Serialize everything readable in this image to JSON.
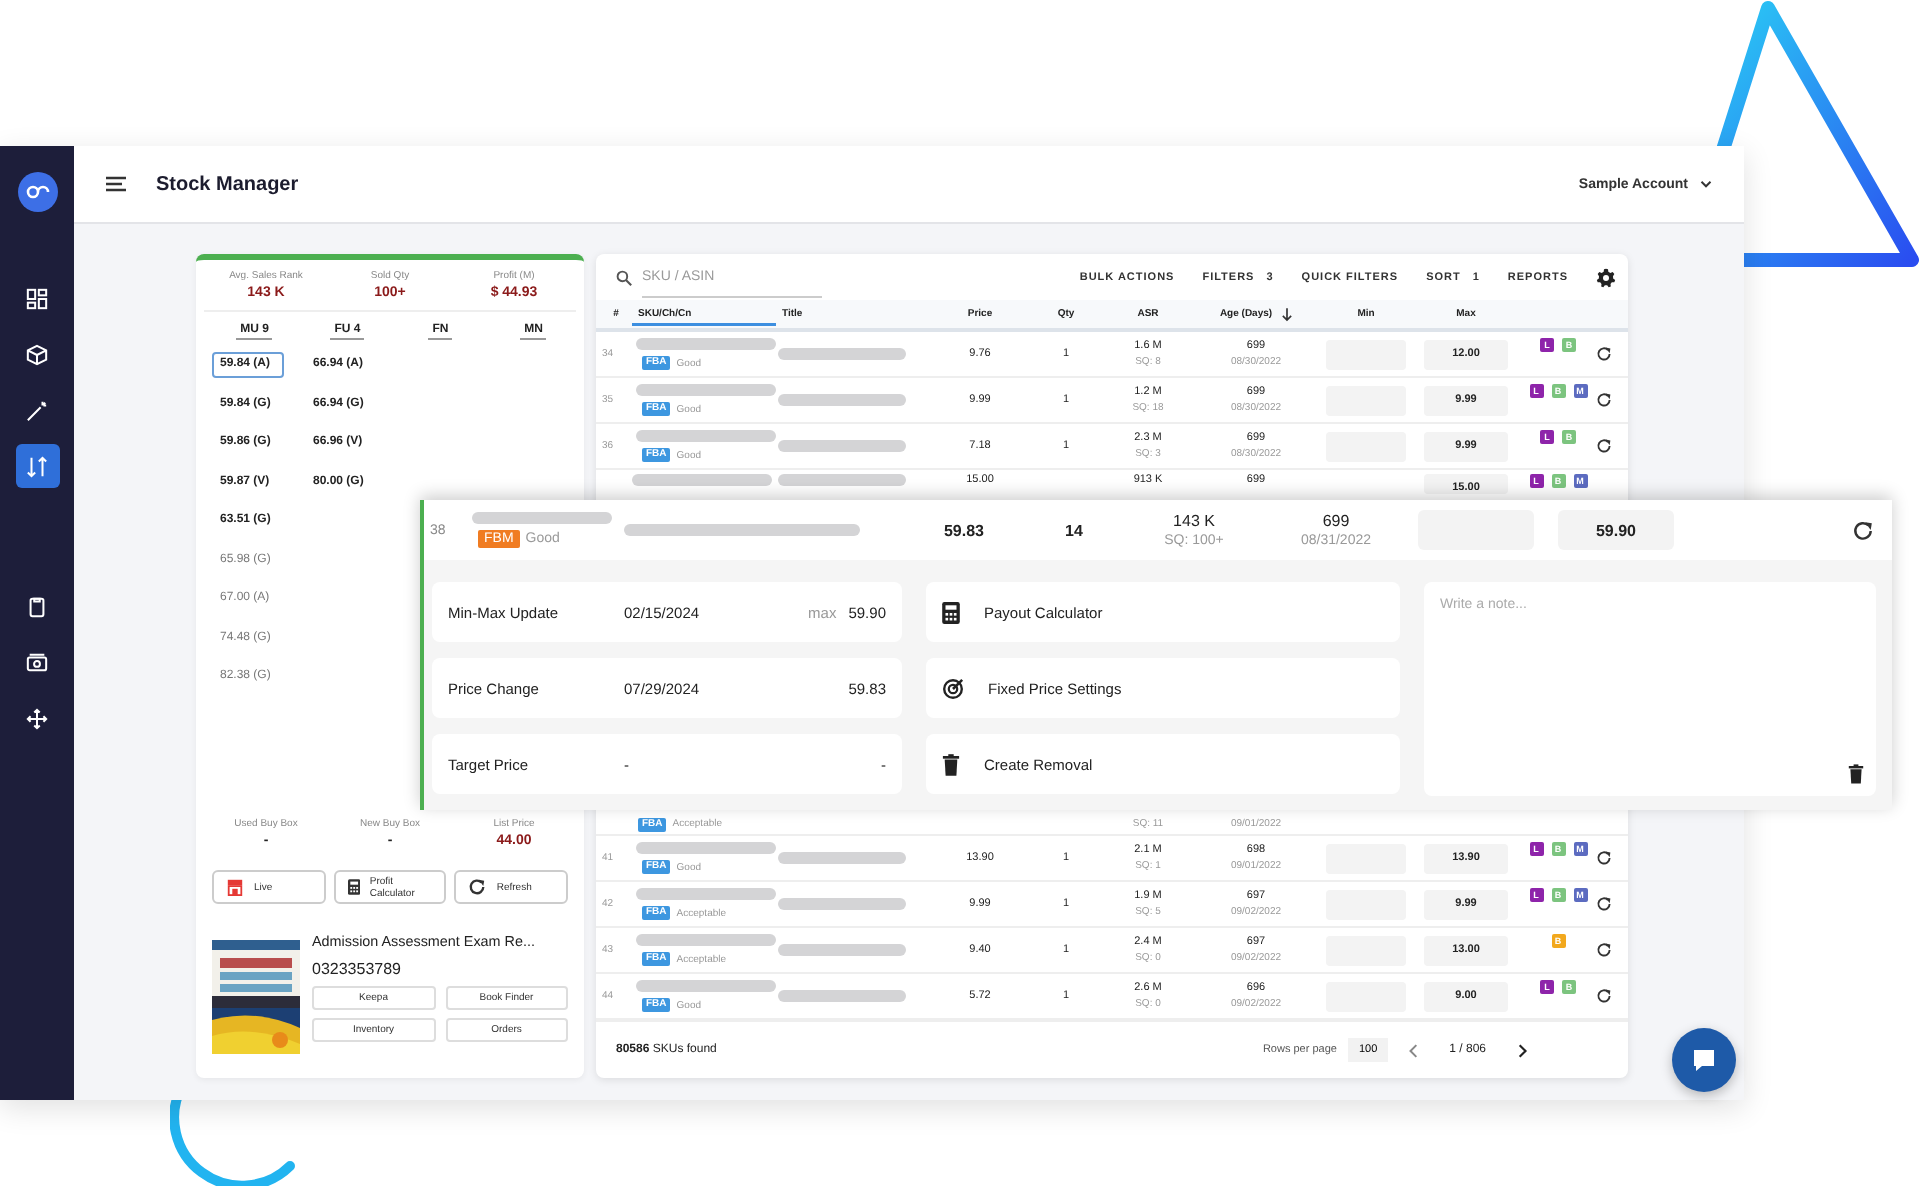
{
  "app": {
    "title": "Stock Manager",
    "account": "Sample Account"
  },
  "sidebar": {
    "items": [
      {
        "kind": "grid",
        "selected": false
      },
      {
        "kind": "cube",
        "selected": false
      },
      {
        "kind": "wand",
        "selected": false
      },
      {
        "kind": "sort",
        "selected": true
      },
      {
        "kind": "clipboard",
        "selected": false
      },
      {
        "kind": "cash",
        "selected": false
      },
      {
        "kind": "move",
        "selected": false
      }
    ]
  },
  "summary": [
    {
      "label": "Avg. Sales Rank",
      "value": "143 K"
    },
    {
      "label": "Sold Qty",
      "value": "100+"
    },
    {
      "label": "Profit (M)",
      "value": "$ 44.93"
    }
  ],
  "offers": [
    {
      "label": "MU 9",
      "prices": [
        {
          "text": "59.84 (A)",
          "selected": true,
          "muted": false
        },
        {
          "text": "59.84 (G)",
          "selected": false,
          "muted": false
        },
        {
          "text": "59.86 (G)",
          "selected": false,
          "muted": false
        },
        {
          "text": "59.87 (V)",
          "selected": false,
          "muted": false
        },
        {
          "text": "63.51 (G)",
          "selected": false,
          "muted": false
        },
        {
          "text": "65.98 (G)",
          "selected": false,
          "muted": true
        },
        {
          "text": "67.00 (A)",
          "selected": false,
          "muted": true
        },
        {
          "text": "74.48 (G)",
          "selected": false,
          "muted": true
        },
        {
          "text": "82.38 (G)",
          "selected": false,
          "muted": true
        }
      ]
    },
    {
      "label": "FU 4",
      "prices": [
        {
          "text": "66.94 (A)",
          "selected": false,
          "muted": false
        },
        {
          "text": "66.94 (G)",
          "selected": false,
          "muted": false
        },
        {
          "text": "66.96 (V)",
          "selected": false,
          "muted": false
        },
        {
          "text": "80.00 (G)",
          "selected": false,
          "muted": false
        }
      ]
    },
    {
      "label": "FN"
    },
    {
      "label": "MN"
    }
  ],
  "buy_box": [
    {
      "label": "Used Buy Box",
      "value": "-"
    },
    {
      "label": "New Buy Box",
      "value": "-"
    },
    {
      "label": "List Price",
      "value": "44.00"
    }
  ],
  "tools": [
    {
      "kind": "live",
      "label": "Live"
    },
    {
      "kind": "calculator",
      "label": "Profit Calculator"
    },
    {
      "kind": "refresh",
      "label": "Refresh"
    }
  ],
  "product": {
    "title": "Admission Assessment Exam Re...",
    "isbn": "0323353789",
    "links": [
      "Keepa",
      "Book Finder",
      "Inventory",
      "Orders"
    ]
  },
  "table": {
    "search_placeholder": "SKU / ASIN",
    "actions": [
      {
        "label": "BULK ACTIONS"
      },
      {
        "label": "FILTERS",
        "count": "3"
      },
      {
        "label": "QUICK FILTERS"
      },
      {
        "label": "SORT",
        "count": "1"
      },
      {
        "label": "REPORTS"
      }
    ],
    "columns": [
      {
        "label": "#",
        "selected": false,
        "sorted": false
      },
      {
        "label": "SKU/Ch/Cn",
        "selected": true,
        "sorted": false
      },
      {
        "label": "Title",
        "selected": false,
        "sorted": false
      },
      {
        "label": "Price",
        "selected": false,
        "sorted": false
      },
      {
        "label": "Qty",
        "selected": false,
        "sorted": false
      },
      {
        "label": "ASR",
        "selected": false,
        "sorted": false
      },
      {
        "label": "Age (Days)",
        "selected": false,
        "sorted": true
      },
      {
        "label": "Min",
        "selected": false,
        "sorted": false
      },
      {
        "label": "Max",
        "selected": false,
        "sorted": false
      }
    ],
    "rows": [
      {
        "kind": "full",
        "num": "34",
        "channel": {
          "text": "FBA",
          "color": "#3d97e0"
        },
        "condition": "Good",
        "price": "9.76",
        "qty": "1",
        "asr": "1.6 M",
        "sq": "SQ: 8",
        "age": "699",
        "date": "08/30/2022",
        "max": "12.00",
        "badges": [
          {
            "text": "L",
            "color": "#8e24aa"
          },
          {
            "text": "B",
            "color": "#7cc47f"
          }
        ]
      },
      {
        "kind": "full",
        "num": "35",
        "channel": {
          "text": "FBA",
          "color": "#3d97e0"
        },
        "condition": "Good",
        "price": "9.99",
        "qty": "1",
        "asr": "1.2 M",
        "sq": "SQ: 18",
        "age": "699",
        "date": "08/30/2022",
        "max": "9.99",
        "badges": [
          {
            "text": "L",
            "color": "#8e24aa"
          },
          {
            "text": "B",
            "color": "#7cc47f"
          },
          {
            "text": "M",
            "color": "#5c6bc0"
          }
        ]
      },
      {
        "kind": "full",
        "num": "36",
        "channel": {
          "text": "FBA",
          "color": "#3d97e0"
        },
        "condition": "Good",
        "price": "7.18",
        "qty": "1",
        "asr": "2.3 M",
        "sq": "SQ: 3",
        "age": "699",
        "date": "08/30/2022",
        "max": "9.99",
        "badges": [
          {
            "text": "L",
            "color": "#8e24aa"
          },
          {
            "text": "B",
            "color": "#7cc47f"
          }
        ]
      },
      {
        "kind": "top",
        "price": "15.00",
        "asr": "913 K",
        "age": "699",
        "max": "15.00",
        "badges": [
          {
            "text": "L",
            "color": "#8e24aa"
          },
          {
            "text": "B",
            "color": "#7cc47f"
          },
          {
            "text": "M",
            "color": "#5c6bc0"
          }
        ]
      },
      {
        "kind": "bottom",
        "channel": {
          "text": "FBA",
          "color": "#3d97e0"
        },
        "condition": "Acceptable",
        "sq": "SQ: 11",
        "date": "09/01/2022"
      },
      {
        "kind": "full",
        "num": "41",
        "channel": {
          "text": "FBA",
          "color": "#3d97e0"
        },
        "condition": "Good",
        "price": "13.90",
        "qty": "1",
        "asr": "2.1 M",
        "sq": "SQ: 1",
        "age": "698",
        "date": "09/01/2022",
        "max": "13.90",
        "badges": [
          {
            "text": "L",
            "color": "#8e24aa"
          },
          {
            "text": "B",
            "color": "#7cc47f"
          },
          {
            "text": "M",
            "color": "#5c6bc0"
          }
        ]
      },
      {
        "kind": "full",
        "num": "42",
        "channel": {
          "text": "FBA",
          "color": "#3d97e0"
        },
        "condition": "Acceptable",
        "price": "9.99",
        "qty": "1",
        "asr": "1.9 M",
        "sq": "SQ: 5",
        "age": "697",
        "date": "09/02/2022",
        "max": "9.99",
        "badges": [
          {
            "text": "L",
            "color": "#8e24aa"
          },
          {
            "text": "B",
            "color": "#7cc47f"
          },
          {
            "text": "M",
            "color": "#5c6bc0"
          }
        ]
      },
      {
        "kind": "full",
        "num": "43",
        "channel": {
          "text": "FBA",
          "color": "#3d97e0"
        },
        "condition": "Acceptable",
        "price": "9.40",
        "qty": "1",
        "asr": "2.4 M",
        "sq": "SQ: 0",
        "age": "697",
        "date": "09/02/2022",
        "max": "13.00",
        "badges": [
          {
            "text": "B",
            "color": "#f2a81d"
          }
        ]
      },
      {
        "kind": "full",
        "num": "44",
        "channel": {
          "text": "FBA",
          "color": "#3d97e0"
        },
        "condition": "Good",
        "price": "5.72",
        "qty": "1",
        "asr": "2.6 M",
        "sq": "SQ: 0",
        "age": "696",
        "date": "09/02/2022",
        "max": "9.00",
        "badges": [
          {
            "text": "L",
            "color": "#8e24aa"
          },
          {
            "text": "B",
            "color": "#7cc47f"
          }
        ]
      }
    ],
    "footer": {
      "count": "**80586** SKUs found",
      "rows_per_page_label": "Rows per page",
      "rows_per_page": "100",
      "page": "1 / 806"
    }
  },
  "expanded_row": {
    "num": "38",
    "channel": {
      "text": "FBM",
      "color": "#f07c22"
    },
    "condition": "Good",
    "price": "59.83",
    "qty": "14",
    "asr": "143 K",
    "sq": "SQ: 100+",
    "age": "699",
    "date": "08/31/2022",
    "max": "59.90",
    "details": [
      {
        "label": "Min-Max Update",
        "date": "02/15/2024",
        "unit": "max",
        "value": "59.90"
      },
      {
        "label": "Price Change",
        "date": "07/29/2024",
        "value": "59.83"
      },
      {
        "label": "Target Price",
        "date": "-",
        "value": "-"
      }
    ],
    "actions": [
      {
        "kind": "calculator",
        "label": "Payout Calculator"
      },
      {
        "kind": "target",
        "label": "Fixed Price Settings"
      },
      {
        "kind": "trash",
        "label": "Create Removal"
      }
    ],
    "note_placeholder": "Write a note..."
  }
}
